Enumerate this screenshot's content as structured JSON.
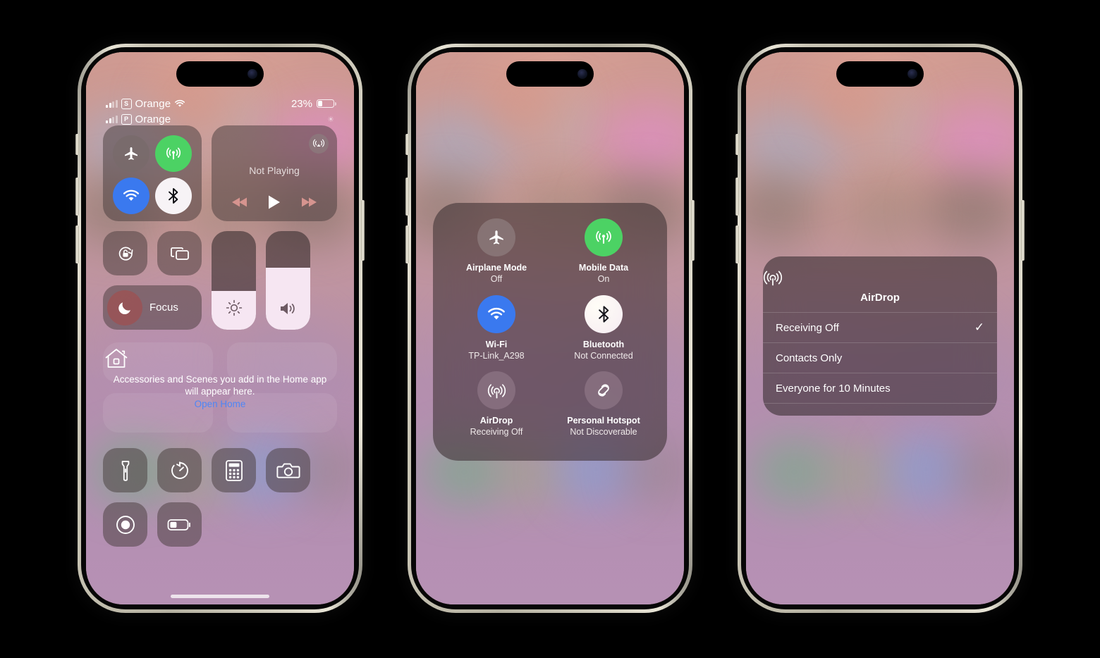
{
  "meta": {
    "device": "iPhone",
    "screens": 3
  },
  "phone1": {
    "status_bar": {
      "sim1_badge": "S",
      "sim1_carrier": "Orange",
      "sim2_badge": "P",
      "sim2_carrier": "Orange",
      "wifi_icon": "wifi-icon",
      "battery_percent": "23%",
      "battery_level": 23,
      "sync_icon": "sync-spinner-icon"
    },
    "connectivity": {
      "airplane": {
        "name": "airplane-mode",
        "state": "off"
      },
      "mobile_data": {
        "name": "mobile-data",
        "state": "on"
      },
      "wifi": {
        "name": "wifi",
        "state": "on"
      },
      "bluetooth": {
        "name": "bluetooth",
        "state": "on"
      }
    },
    "media": {
      "title": "Not Playing",
      "airplay_icon": "airplay-icon",
      "prev_icon": "rewind-icon",
      "play_icon": "play-icon",
      "next_icon": "fast-forward-icon"
    },
    "toggles": {
      "rotation_lock_icon": "rotation-lock-icon",
      "screen_mirroring_icon": "screen-mirroring-icon",
      "focus_label": "Focus",
      "focus_icon": "moon-icon"
    },
    "sliders": {
      "brightness_icon": "brightness-icon",
      "brightness_value": 39,
      "volume_icon": "volume-icon",
      "volume_value": 63
    },
    "home_widget": {
      "icon": "home-icon",
      "message": "Accessories and Scenes you add in the Home app will appear here.",
      "link": "Open Home"
    },
    "apps": [
      {
        "name": "flashlight",
        "icon": "flashlight-icon"
      },
      {
        "name": "timer",
        "icon": "timer-icon"
      },
      {
        "name": "calculator",
        "icon": "calculator-icon"
      },
      {
        "name": "camera",
        "icon": "camera-icon"
      },
      {
        "name": "screen-record",
        "icon": "record-icon"
      },
      {
        "name": "low-power-mode",
        "icon": "battery-icon"
      }
    ]
  },
  "phone2": {
    "panel_title": "connectivity-panel",
    "items": [
      {
        "name": "Airplane Mode",
        "value": "Off",
        "icon": "airplane-icon",
        "style": "dim"
      },
      {
        "name": "Mobile Data",
        "value": "On",
        "icon": "cellular-icon",
        "style": "green"
      },
      {
        "name": "Wi-Fi",
        "value": "TP-Link_A298",
        "icon": "wifi-icon",
        "style": "blue"
      },
      {
        "name": "Bluetooth",
        "value": "Not Connected",
        "icon": "bluetooth-icon",
        "style": "white"
      },
      {
        "name": "AirDrop",
        "value": "Receiving Off",
        "icon": "airdrop-icon",
        "style": "purple"
      },
      {
        "name": "Personal Hotspot",
        "value": "Not Discoverable",
        "icon": "hotspot-icon",
        "style": "purple"
      }
    ]
  },
  "phone3": {
    "menu": {
      "icon": "airdrop-icon",
      "title": "AirDrop",
      "options": [
        {
          "label": "Receiving Off",
          "selected": true,
          "check": "✓"
        },
        {
          "label": "Contacts Only",
          "selected": false,
          "check": ""
        },
        {
          "label": "Everyone for 10 Minutes",
          "selected": false,
          "check": ""
        }
      ]
    }
  },
  "colors": {
    "accent_green": "#4cd264",
    "accent_blue": "#3a79ef",
    "link_blue": "#4e86f5",
    "white": "#ffffff"
  }
}
